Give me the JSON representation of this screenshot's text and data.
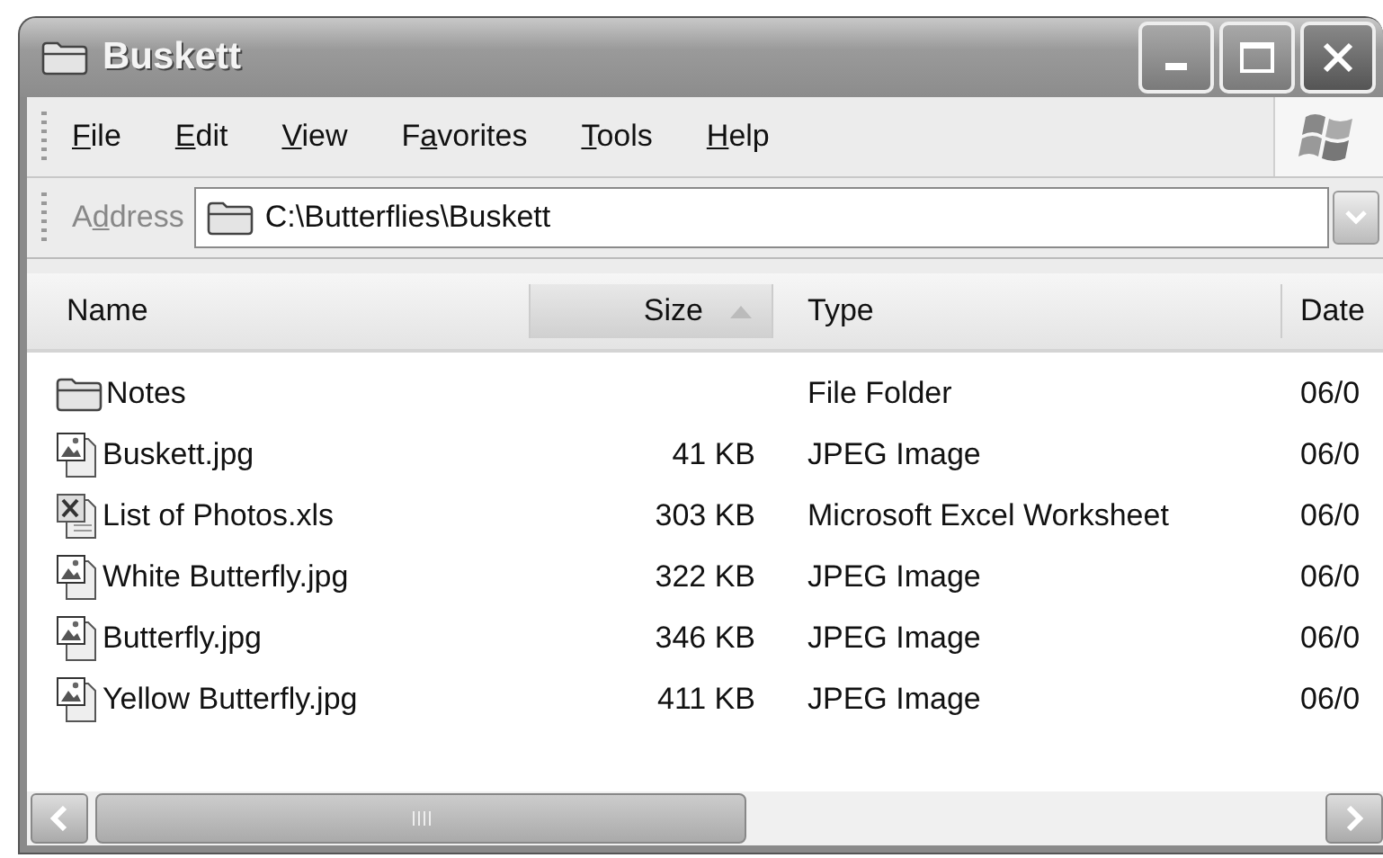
{
  "window": {
    "title": "Buskett"
  },
  "menu": [
    {
      "key": "F",
      "post": "ile"
    },
    {
      "key": "E",
      "post": "dit"
    },
    {
      "key": "V",
      "post": "iew"
    },
    {
      "pre": "F",
      "key": "a",
      "post": "vorites"
    },
    {
      "key": "T",
      "post": "ools"
    },
    {
      "key": "H",
      "post": "elp"
    }
  ],
  "address": {
    "label": {
      "pre": "A",
      "key": "d",
      "post": "dress"
    },
    "value": "C:\\Butterflies\\Buskett"
  },
  "table": {
    "columns": [
      {
        "label": "Name",
        "sorted": false
      },
      {
        "label": "Size",
        "sorted": true
      },
      {
        "label": "Type",
        "sorted": false
      },
      {
        "label": "Date",
        "sorted": false
      }
    ],
    "rows": [
      {
        "kind": "folder",
        "name": "Notes",
        "type": "File Folder",
        "date": "06/0"
      },
      {
        "kind": "image",
        "name": "Buskett.jpg",
        "size": "41 KB",
        "type": "JPEG Image",
        "date": "06/0"
      },
      {
        "kind": "spreadsheet",
        "name": "List of Photos.xls",
        "size": "303 KB",
        "type": "Microsoft Excel Worksheet",
        "date": "06/0"
      },
      {
        "kind": "image",
        "name": "White Butterfly.jpg",
        "size": "322 KB",
        "type": "JPEG Image",
        "date": "06/0"
      },
      {
        "kind": "image",
        "name": "Butterfly.jpg",
        "size": "346 KB",
        "type": "JPEG Image",
        "date": "06/0"
      },
      {
        "kind": "image",
        "name": "Yellow Butterfly.jpg",
        "size": "411 KB",
        "type": "JPEG Image",
        "date": "06/0"
      }
    ]
  }
}
